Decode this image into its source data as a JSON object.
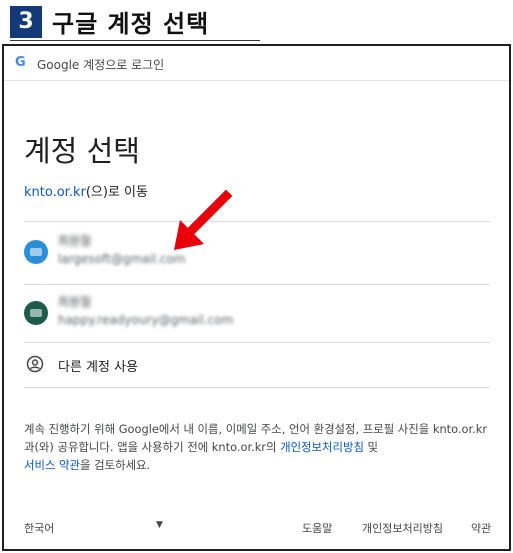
{
  "step": {
    "number": "3",
    "title": "구글 계정 선택"
  },
  "dialog": {
    "topbar": {
      "logo": "G",
      "text": "Google 계정으로 로그인"
    },
    "title": "계정 선택",
    "redirect": {
      "domain": "knto.or.kr",
      "suffix": "(으)로 이동"
    },
    "accounts": [
      {
        "name": "최원철",
        "email": "largesoft@gmail.com",
        "avatar_color": "#2a8fd6"
      },
      {
        "name": "최원철",
        "email": "happy.readyoury@gmail.com",
        "avatar_color": "#1e5b4a"
      }
    ],
    "use_other": "다른 계정 사용",
    "disclaimer": {
      "part1": "계속 진행하기 위해 Google에서 내 이름, 이메일 주소, 언어 환경설정, 프로필 사진을 knto.or.kr과(와) 공유합니다. 앱을 사용하기 전에 knto.or.kr의 ",
      "privacy_link": "개인정보처리방침",
      "and": " 및",
      "terms_link": "서비스 약관",
      "part2": "을 검토하세요."
    },
    "footer": {
      "language": "한국어",
      "help": "도움말",
      "privacy": "개인정보처리방침",
      "terms": "약관"
    }
  },
  "icons": {
    "logo": "google-g-icon",
    "person": "account-circle-icon",
    "caret": "dropdown-caret-icon",
    "arrow": "red-pointer-arrow"
  },
  "colors": {
    "step_badge": "#123a79",
    "link": "#0b57d0",
    "arrow": "#e8000b"
  }
}
